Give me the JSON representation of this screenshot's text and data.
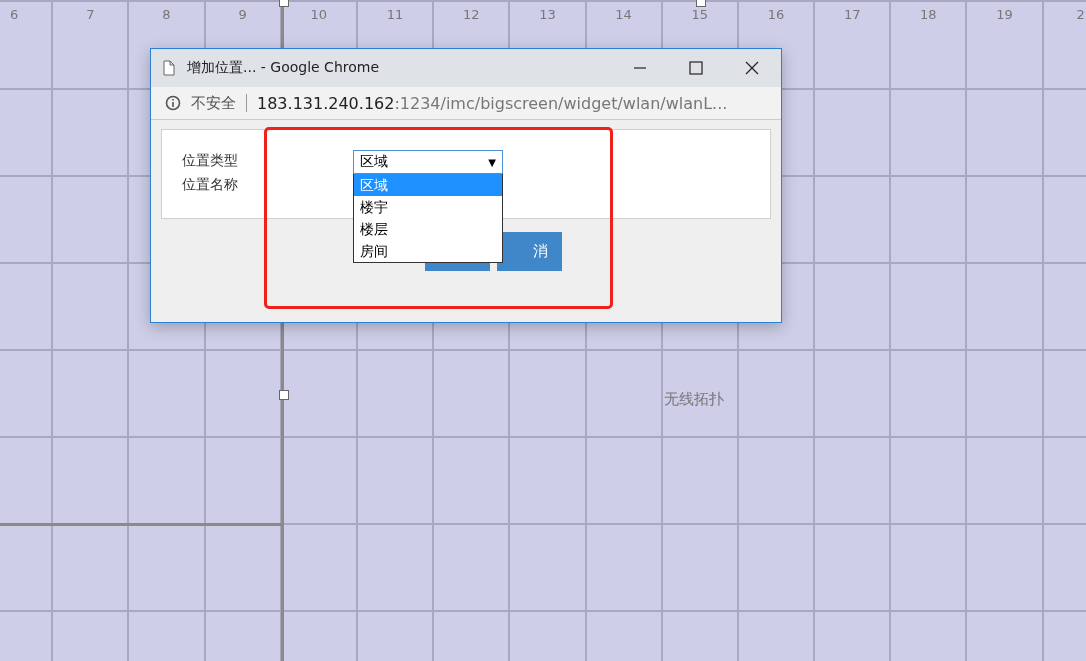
{
  "ruler": [
    "6",
    "7",
    "8",
    "9",
    "10",
    "11",
    "12",
    "13",
    "14",
    "15",
    "16",
    "17",
    "18",
    "19",
    "2"
  ],
  "canvas_label": "无线拓扑",
  "window": {
    "title": "增加位置... - Google Chrome"
  },
  "address_bar": {
    "security": "不安全",
    "host": "183.131.240.162",
    "path": ":1234/imc/bigscreen/widget/wlan/wlanL..."
  },
  "form": {
    "fields": [
      {
        "label": "位置类型"
      },
      {
        "label": "位置名称"
      }
    ],
    "select": {
      "value": "区域",
      "caret": "▼"
    },
    "options": [
      {
        "label": "区域",
        "selected": true
      },
      {
        "label": "楼宇",
        "selected": false
      },
      {
        "label": "楼层",
        "selected": false
      },
      {
        "label": "房间",
        "selected": false
      }
    ],
    "buttons": [
      {
        "kind": "blank"
      },
      {
        "kind": "text",
        "label": "消"
      }
    ]
  }
}
